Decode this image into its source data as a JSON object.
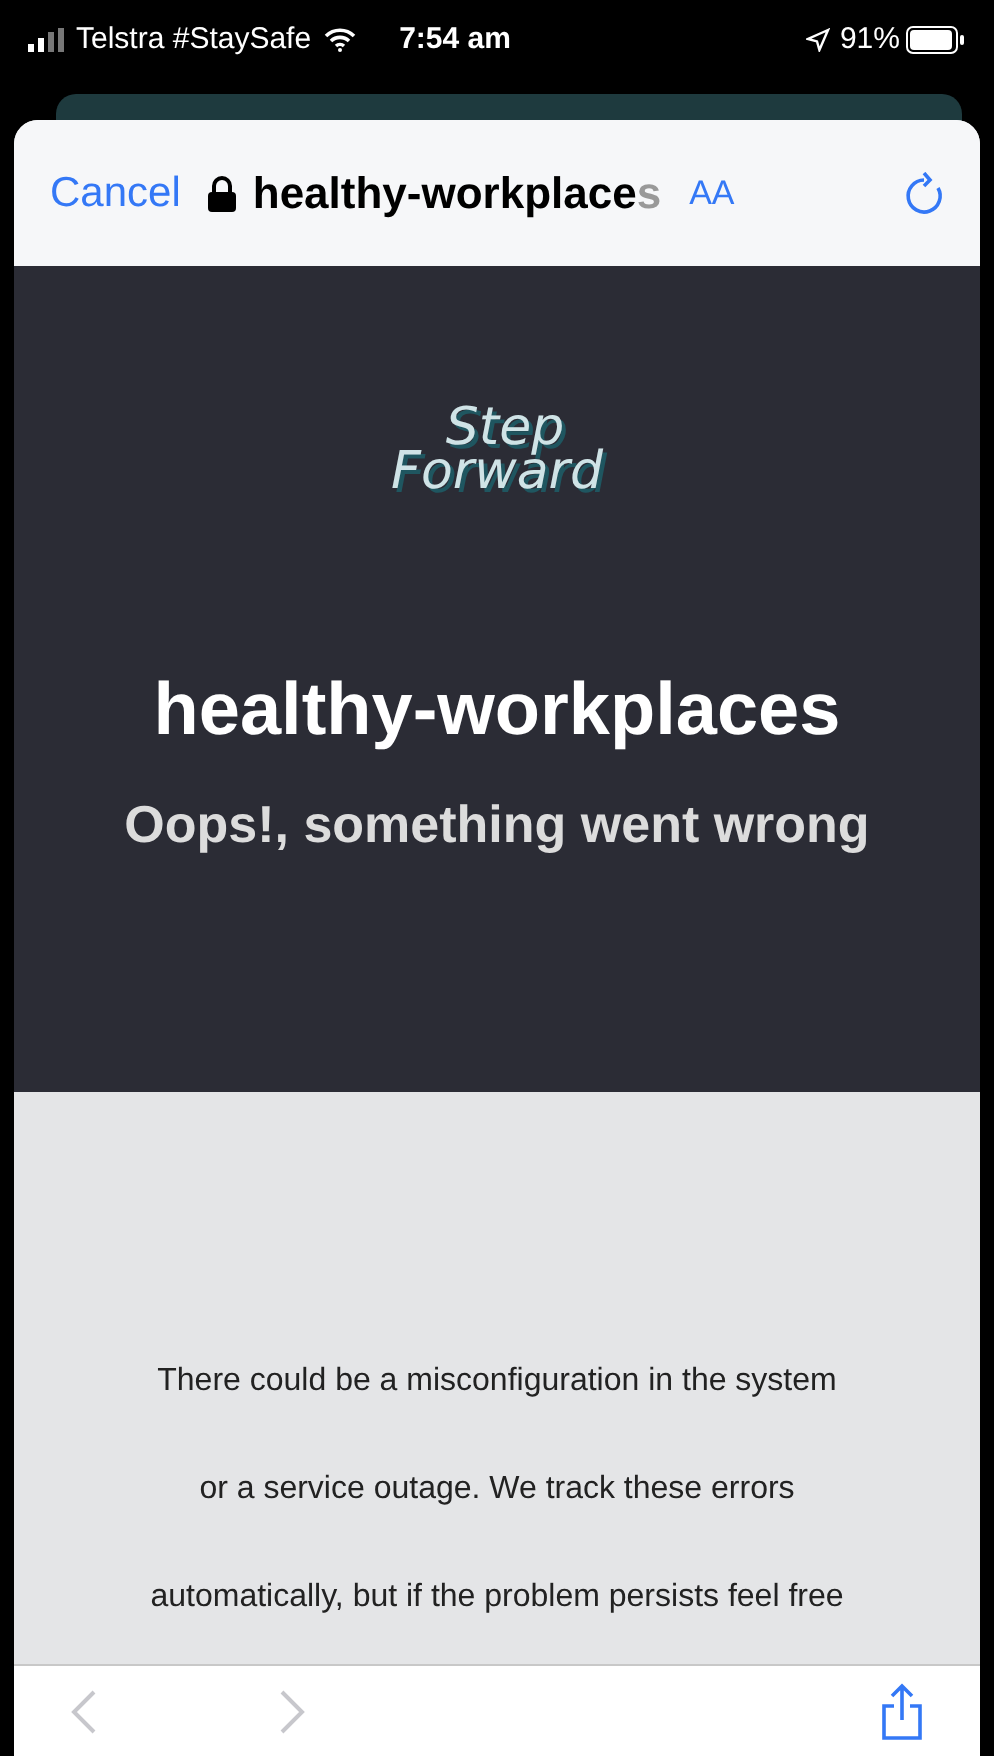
{
  "status_bar": {
    "carrier": "Telstra #StaySafe",
    "time": "7:54 am",
    "battery": "91%"
  },
  "address_bar": {
    "cancel": "Cancel",
    "url": "healthy-workplace",
    "url_cut": "s",
    "text_size": "AA"
  },
  "page": {
    "logo": [
      "Step",
      "Forward"
    ],
    "title": "healthy-workplaces",
    "subtitle": "Oops!, something went wrong",
    "message_lines": [
      "There could be a misconfiguration in the system",
      "or a service outage. We track these errors",
      "automatically, but if the problem persists feel free"
    ]
  },
  "toolbar": {
    "back_disabled": true,
    "forward_disabled": true
  }
}
